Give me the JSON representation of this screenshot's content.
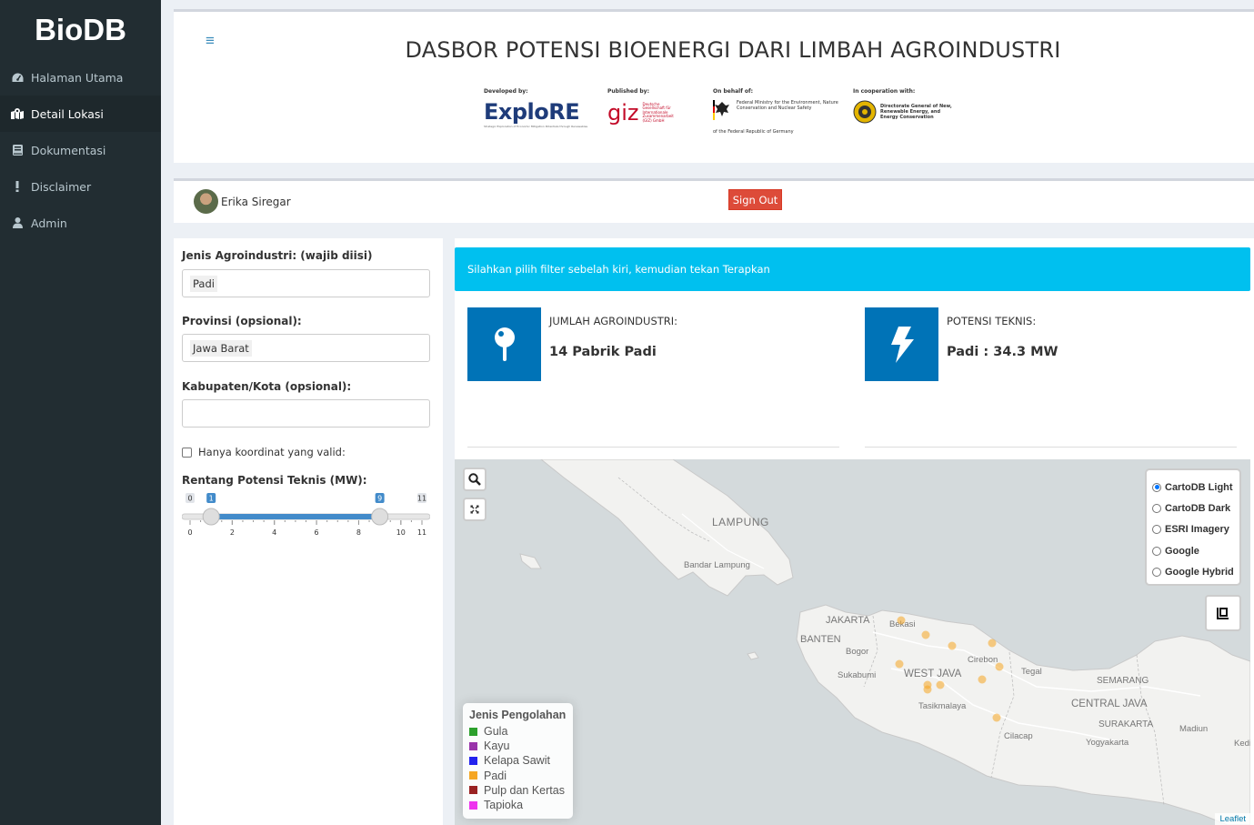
{
  "app": {
    "brand": "BioDB"
  },
  "sidebar": {
    "items": [
      {
        "label": "Halaman Utama",
        "icon": "dashboard-icon",
        "active": false
      },
      {
        "label": "Detail Lokasi",
        "icon": "map-marked-icon",
        "active": true
      },
      {
        "label": "Dokumentasi",
        "icon": "book-icon",
        "active": false
      },
      {
        "label": "Disclaimer",
        "icon": "exclamation-icon",
        "active": false
      },
      {
        "label": "Admin",
        "icon": "user-icon",
        "active": false
      }
    ]
  },
  "header": {
    "title": "DASBOR POTENSI BIOENERGI DARI LIMBAH AGROINDUSTRI",
    "logos": {
      "developed_by": "Developed by:",
      "explore": "ExploRE",
      "explore_sub": "Strategic Exploration of Economic Mitigation Potentials through Renewables",
      "published_by": "Published by:",
      "giz": "giz",
      "giz_sub": "Deutsche Gesellschaft für Internationale Zusammenarbeit (GIZ) GmbH",
      "on_behalf": "On behalf of:",
      "ministry": "Federal Ministry for the Environment, Nature Conservation and Nuclear Safety",
      "ministry_sub": "of the Federal Republic of Germany",
      "coop": "In cooperation with:",
      "dg": "Directorate General of New, Renewable Energy, and Energy Conservation"
    }
  },
  "user": {
    "name": "Erika Siregar",
    "signout_label": "Sign Out"
  },
  "filters": {
    "agro_label": "Jenis Agroindustri: (wajib diisi)",
    "agro_value": "Padi",
    "prov_label": "Provinsi (opsional):",
    "prov_value": "Jawa Barat",
    "kab_label": "Kabupaten/Kota (opsional):",
    "kab_value": "",
    "valid_label": "Hanya koordinat yang valid:",
    "valid_checked": false,
    "range_label": "Rentang Potensi Teknis (MW):",
    "range_min": 0,
    "range_max": 11,
    "range_from": 1,
    "range_to": 9,
    "ticks": [
      "0",
      "2",
      "4",
      "6",
      "8",
      "10",
      "11"
    ]
  },
  "content": {
    "info": "Silahkan pilih filter sebelah kiri, kemudian tekan Terapkan",
    "box1": {
      "label": "JUMLAH AGROINDUSTRI:",
      "value": "14 Pabrik Padi",
      "icon": "map-pin-icon"
    },
    "box2": {
      "label": "POTENSI TEKNIS:",
      "value": "Padi : 34.3 MW",
      "icon": "bolt-icon"
    }
  },
  "map": {
    "layers": [
      {
        "label": "CartoDB Light",
        "checked": true
      },
      {
        "label": "CartoDB Dark",
        "checked": false
      },
      {
        "label": "ESRI Imagery",
        "checked": false
      },
      {
        "label": "Google",
        "checked": false
      },
      {
        "label": "Google Hybrid",
        "checked": false
      }
    ],
    "legend_title": "Jenis Pengolahan",
    "legend": [
      {
        "label": "Gula",
        "color": "#2ca02c"
      },
      {
        "label": "Kayu",
        "color": "#9933aa"
      },
      {
        "label": "Kelapa Sawit",
        "color": "#2222ee"
      },
      {
        "label": "Padi",
        "color": "#f5a623"
      },
      {
        "label": "Pulp dan Kertas",
        "color": "#992222"
      },
      {
        "label": "Tapioka",
        "color": "#ee33ee"
      }
    ],
    "place_labels": {
      "lampung": "LAMPUNG",
      "bandar_lampung": "Bandar Lampung",
      "jakarta": "JAKARTA",
      "bekasi": "Bekasi",
      "banten": "BANTEN",
      "bogor": "Bogor",
      "sukabumi": "Sukabumi",
      "west_java": "WEST JAVA",
      "cirebon": "Cirebon",
      "tegal": "Tegal",
      "semarang": "SEMARANG",
      "central_java": "CENTRAL JAVA",
      "tasikmalaya": "Tasikmalaya",
      "cilacap": "Cilacap",
      "surakarta": "SURAKARTA",
      "yogyakarta": "Yogyakarta",
      "madiun": "Madiun",
      "kediri": "Kedi"
    },
    "attribution": "Leaflet"
  },
  "colors": {
    "sidebar": "#222d32",
    "primary": "#0073b7",
    "info": "#00c0ef",
    "danger": "#dd4b39",
    "accent": "#3c8dbc"
  }
}
